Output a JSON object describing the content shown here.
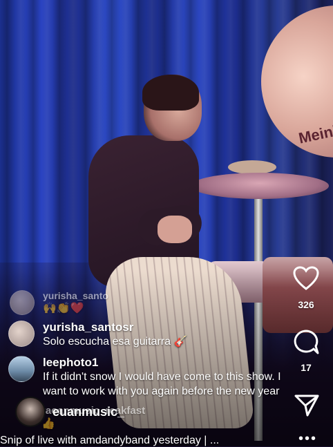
{
  "comments": [
    {
      "username": "yurisha_santosr",
      "text": "Solo escucha esa guitarra 🎸",
      "avatar_icon": "woman-avatar"
    },
    {
      "username": "leephoto1",
      "text": "If it didn't snow I would have come to this show. I want to work with you again before the new year",
      "avatar_icon": "landscape-avatar"
    },
    {
      "username": "raoanmusic_reakfast",
      "text": "👍"
    }
  ],
  "faded_comment": {
    "username": "yurisha_santo",
    "text": "🙌👏❤️"
  },
  "rail": {
    "likes_count": "326",
    "comments_count": "17",
    "like_icon": "heart-icon",
    "comment_icon": "speech-bubble-icon",
    "share_icon": "paper-plane-icon",
    "more_icon": "more-dots-icon"
  },
  "host": {
    "username": "euanmusic_"
  },
  "caption": "Snip of live with amdandyband yesterday | ...",
  "more_label": "•••",
  "cymbal_logo": "Meinl"
}
